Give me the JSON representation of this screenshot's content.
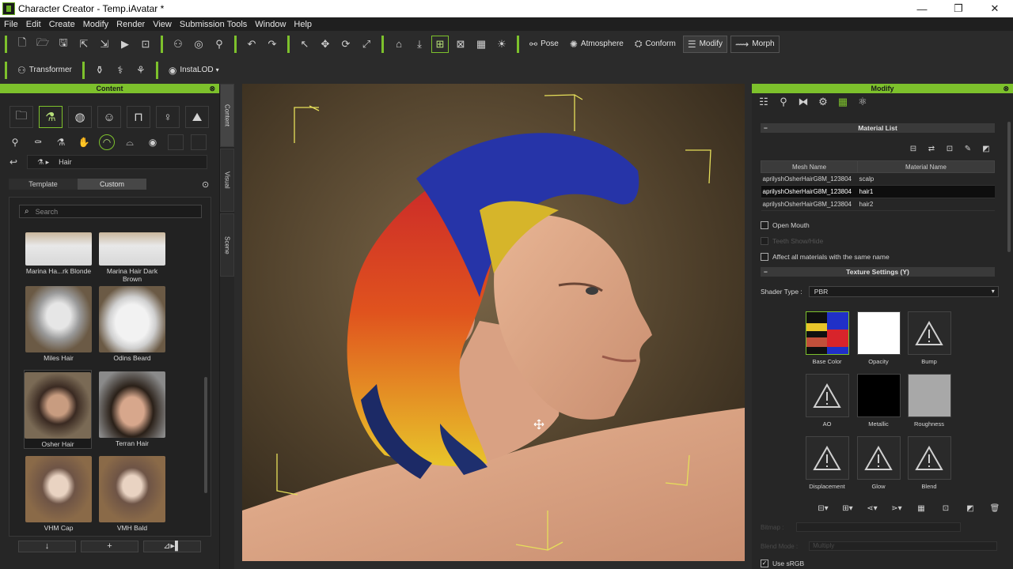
{
  "window": {
    "title": "Character Creator - Temp.iAvatar *",
    "min": "—",
    "max": "❐",
    "close": "✕"
  },
  "menu": [
    "File",
    "Edit",
    "Create",
    "Modify",
    "Render",
    "View",
    "Submission Tools",
    "Window",
    "Help"
  ],
  "toolbar": {
    "pose": "Pose",
    "atmosphere": "Atmosphere",
    "conform": "Conform",
    "modify": "Modify",
    "morph": "Morph",
    "transformer": "Transformer",
    "instalod": "InstaLOD"
  },
  "content": {
    "header": "Content",
    "close": "⊗",
    "path": "Hair",
    "tabs": [
      "Template",
      "Custom"
    ],
    "search_placeholder": "Search",
    "items": [
      {
        "label": "Marina Ha...rk Blonde"
      },
      {
        "label": "Marina Hair Dark Brown"
      },
      {
        "label": "Miles Hair"
      },
      {
        "label": "Odins Beard"
      },
      {
        "label": "Osher Hair"
      },
      {
        "label": "Terran Hair"
      },
      {
        "label": "VHM Cap"
      },
      {
        "label": "VMH Bald"
      }
    ],
    "bottom_buttons": [
      "↓",
      "+",
      "⊿▸▌"
    ]
  },
  "side_tabs": [
    "Content",
    "Visual",
    "Scene"
  ],
  "modify": {
    "header": "Modify",
    "close": "⊗",
    "material_list": "Material List",
    "columns": [
      "Mesh Name",
      "Material Name"
    ],
    "rows": [
      {
        "mesh": "aprilyshOsherHairG8M_123804",
        "material": "scalp"
      },
      {
        "mesh": "aprilyshOsherHairG8M_123804",
        "material": "hair1"
      },
      {
        "mesh": "aprilyshOsherHairG8M_123804",
        "material": "hair2"
      }
    ],
    "open_mouth": "Open Mouth",
    "teeth": "Teeth Show/Hide",
    "affect_all": "Affect all materials with the same name",
    "texture_settings": "Texture Settings (Y)",
    "shader_label": "Shader Type :",
    "shader_value": "PBR",
    "slots": [
      "Base Color",
      "Opacity",
      "Bump",
      "AO",
      "Metallic",
      "Roughness",
      "Displacement",
      "Glow",
      "Blend"
    ],
    "bitmap_label": "Bitmap :",
    "blend_label": "Blend Mode :",
    "blend_value": "Multiply",
    "use_srgb": "Use sRGB"
  },
  "colors": {
    "accent": "#7dc12c",
    "selected_row": "#0e0e0e"
  }
}
